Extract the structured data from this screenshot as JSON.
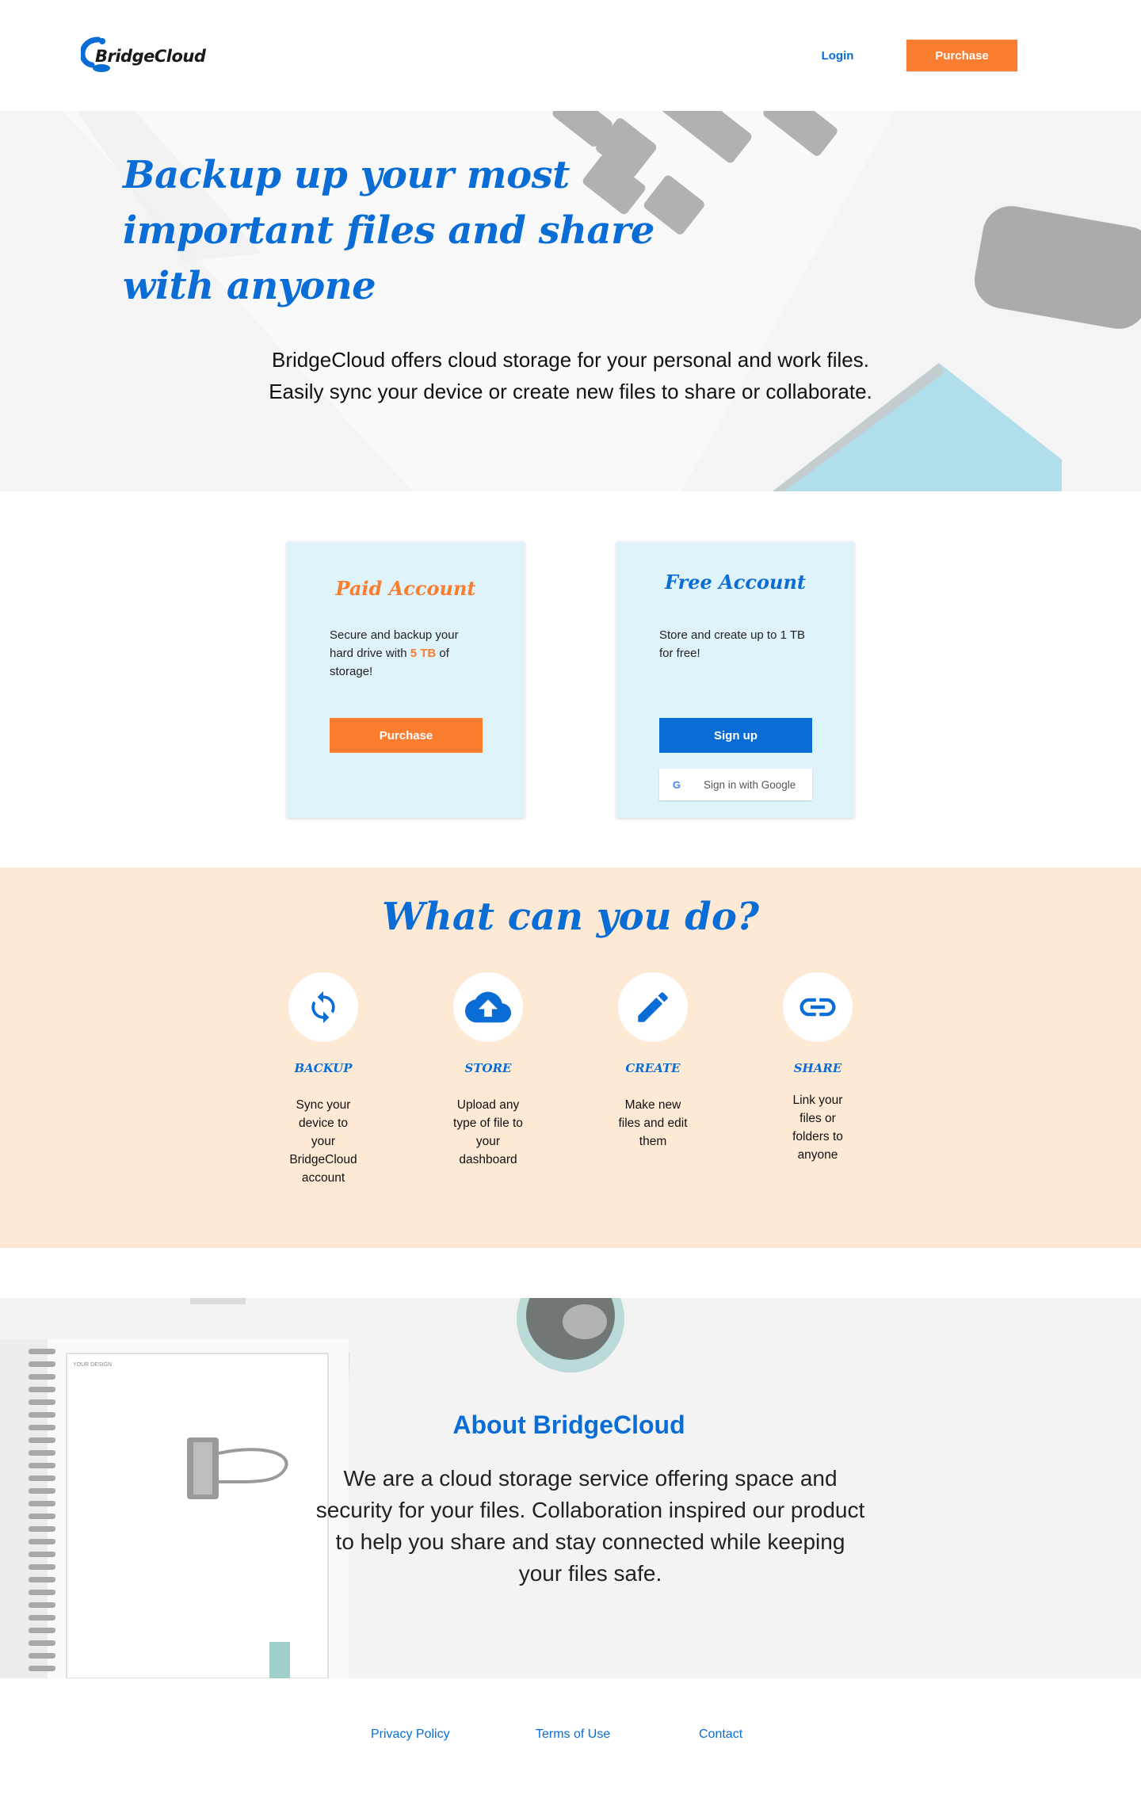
{
  "header": {
    "logo_text": "BridgeCloud",
    "login_label": "Login",
    "purchase_label": "Purchase"
  },
  "hero": {
    "title": "Backup up your most important files and share with anyone",
    "description": "BridgeCloud offers cloud storage for your personal and work files. Easily sync your device or create new files to share or collaborate."
  },
  "plans": {
    "paid": {
      "title": "Paid Account",
      "text_before": "Secure and backup your hard drive with ",
      "highlight": "5 TB",
      "text_after": " of storage!",
      "button": "Purchase"
    },
    "free": {
      "title": "Free Account",
      "text": "Store and create up to 1 TB for free!",
      "button": "Sign up",
      "google_button": "Sign in with Google",
      "google_letter": "G"
    }
  },
  "features": {
    "title": "What can you do?",
    "items": [
      {
        "label": "BACKUP",
        "desc": "Sync your device to your BridgeCloud account",
        "icon": "sync-icon"
      },
      {
        "label": "STORE",
        "desc": "Upload any type of file to your dashboard",
        "icon": "cloud-upload-icon"
      },
      {
        "label": "CREATE",
        "desc": "Make new files and edit them",
        "icon": "pencil-icon"
      },
      {
        "label": "SHARE",
        "desc": "Link your files or folders to anyone",
        "icon": "link-icon"
      }
    ]
  },
  "about": {
    "title": "About BridgeCloud",
    "text": "We are a cloud storage service offering space and security for your files. Collaboration inspired our product to help you share and stay connected while keeping your files safe.",
    "notebook_label": "YOUR DESIGN"
  },
  "footer": {
    "privacy": "Privacy Policy",
    "terms": "Terms of Use",
    "contact": "Contact"
  },
  "colors": {
    "primary": "#0a6dd6",
    "accent": "#fb7d2f",
    "card_bg": "#dff3fb",
    "features_bg": "#fde9d4"
  }
}
